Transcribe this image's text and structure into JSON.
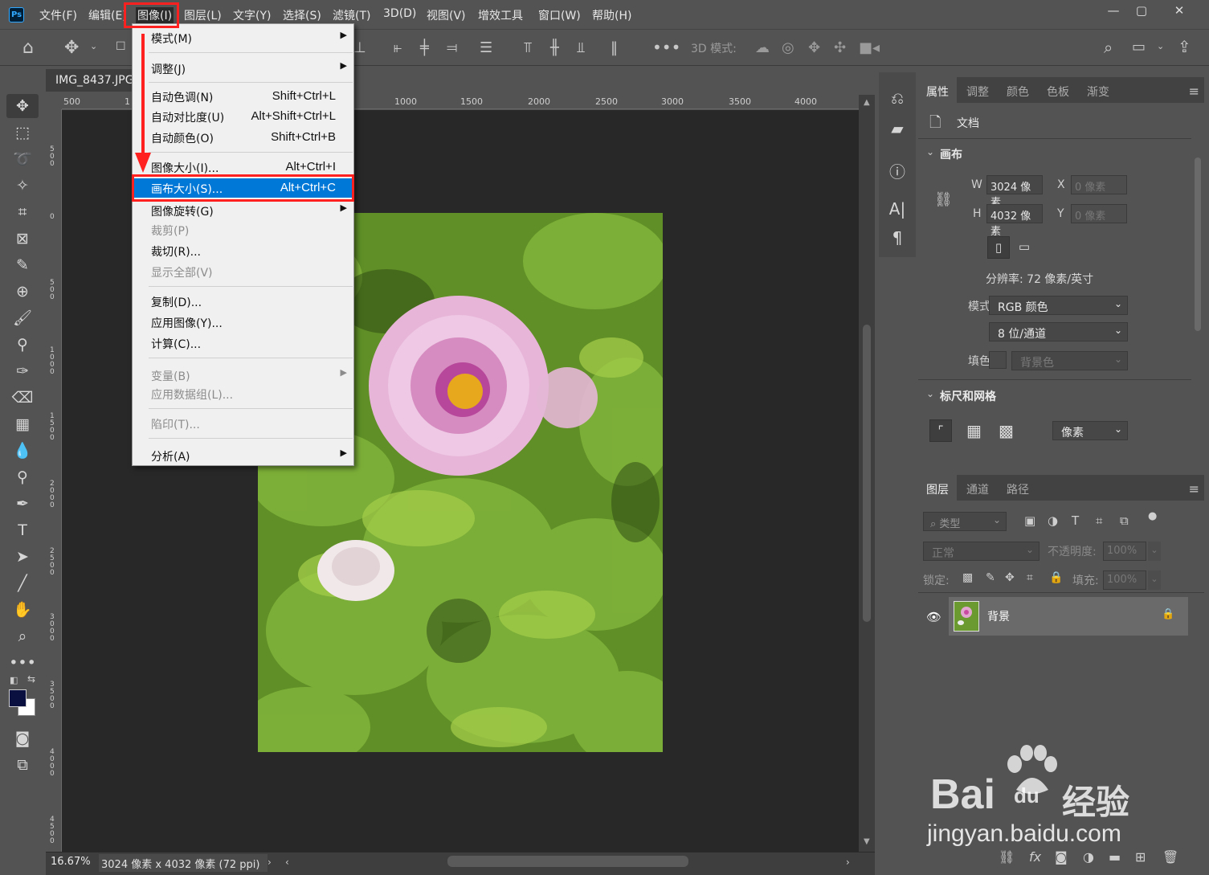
{
  "app": {
    "name": "Ps"
  },
  "menubar": {
    "items": [
      "文件(F)",
      "编辑(E)",
      "图像(I)",
      "图层(L)",
      "文字(Y)",
      "选择(S)",
      "滤镜(T)",
      "3D(D)",
      "视图(V)",
      "增效工具",
      "窗口(W)",
      "帮助(H)"
    ],
    "window_controls": [
      "—",
      "▢",
      "✕"
    ]
  },
  "options_bar": {
    "mode3d_label": "3D 模式:"
  },
  "document": {
    "tab_title": "IMG_8437.JPG",
    "zoom": "16.67%",
    "size_info": "3024 像素 x 4032 像素 (72 ppi)"
  },
  "rulers": {
    "horizontal": [
      "500",
      "1",
      "1000",
      "1500",
      "2000",
      "2500",
      "3000",
      "3500",
      "4000"
    ],
    "vertical": [
      "500",
      "0",
      "500",
      "1000",
      "1500",
      "2000",
      "2500",
      "3000",
      "3500",
      "4000",
      "4500"
    ]
  },
  "image_menu": {
    "items": [
      {
        "label": "模式(M)",
        "shortcut": "",
        "submenu": true,
        "disabled": false
      },
      {
        "label": "调整(J)",
        "shortcut": "",
        "submenu": true,
        "disabled": false
      },
      {
        "label": "自动色调(N)",
        "shortcut": "Shift+Ctrl+L",
        "submenu": false,
        "disabled": false
      },
      {
        "label": "自动对比度(U)",
        "shortcut": "Alt+Shift+Ctrl+L",
        "submenu": false,
        "disabled": false
      },
      {
        "label": "自动颜色(O)",
        "shortcut": "Shift+Ctrl+B",
        "submenu": false,
        "disabled": false
      },
      {
        "label": "图像大小(I)...",
        "shortcut": "Alt+Ctrl+I",
        "submenu": false,
        "disabled": false
      },
      {
        "label": "画布大小(S)...",
        "shortcut": "Alt+Ctrl+C",
        "submenu": false,
        "disabled": false,
        "highlighted": true
      },
      {
        "label": "图像旋转(G)",
        "shortcut": "",
        "submenu": true,
        "disabled": false
      },
      {
        "label": "裁剪(P)",
        "shortcut": "",
        "submenu": false,
        "disabled": true
      },
      {
        "label": "裁切(R)...",
        "shortcut": "",
        "submenu": false,
        "disabled": false
      },
      {
        "label": "显示全部(V)",
        "shortcut": "",
        "submenu": false,
        "disabled": true
      },
      {
        "label": "复制(D)...",
        "shortcut": "",
        "submenu": false,
        "disabled": false
      },
      {
        "label": "应用图像(Y)...",
        "shortcut": "",
        "submenu": false,
        "disabled": false
      },
      {
        "label": "计算(C)...",
        "shortcut": "",
        "submenu": false,
        "disabled": false
      },
      {
        "label": "变量(B)",
        "shortcut": "",
        "submenu": true,
        "disabled": true
      },
      {
        "label": "应用数据组(L)...",
        "shortcut": "",
        "submenu": false,
        "disabled": true
      },
      {
        "label": "陷印(T)...",
        "shortcut": "",
        "submenu": false,
        "disabled": true
      },
      {
        "label": "分析(A)",
        "shortcut": "",
        "submenu": true,
        "disabled": false
      }
    ]
  },
  "properties_panel": {
    "tabs": [
      "属性",
      "调整",
      "颜色",
      "色板",
      "渐变"
    ],
    "doc_label": "文档",
    "canvas_section": "画布",
    "w_label": "W",
    "w_value": "3024 像素",
    "h_label": "H",
    "h_value": "4032 像素",
    "x_label": "X",
    "x_value": "0 像素",
    "y_label": "Y",
    "y_value": "0 像素",
    "resolution": "分辨率: 72 像素/英寸",
    "mode_label": "模式",
    "mode_value": "RGB 颜色",
    "depth_value": "8 位/通道",
    "fill_label": "填色",
    "fill_value": "背景色",
    "rulers_section": "标尺和网格",
    "unit_value": "像素"
  },
  "layers_panel": {
    "tabs": [
      "图层",
      "通道",
      "路径"
    ],
    "filter_label": "类型",
    "blend_mode": "正常",
    "opacity_label": "不透明度:",
    "opacity_value": "100%",
    "lock_label": "锁定:",
    "fill_label": "填充:",
    "fill_value": "100%",
    "layers": [
      {
        "name": "背景",
        "visible": true,
        "locked": true
      }
    ]
  },
  "watermark": {
    "brand": "Bai",
    "brand_suffix": "经验",
    "url": "jingyan.baidu.com",
    "du": "du"
  },
  "colors": {
    "accent": "#0078d7",
    "annotation": "#ff2020",
    "foreground": "#0a1040",
    "background": "#ffffff"
  }
}
